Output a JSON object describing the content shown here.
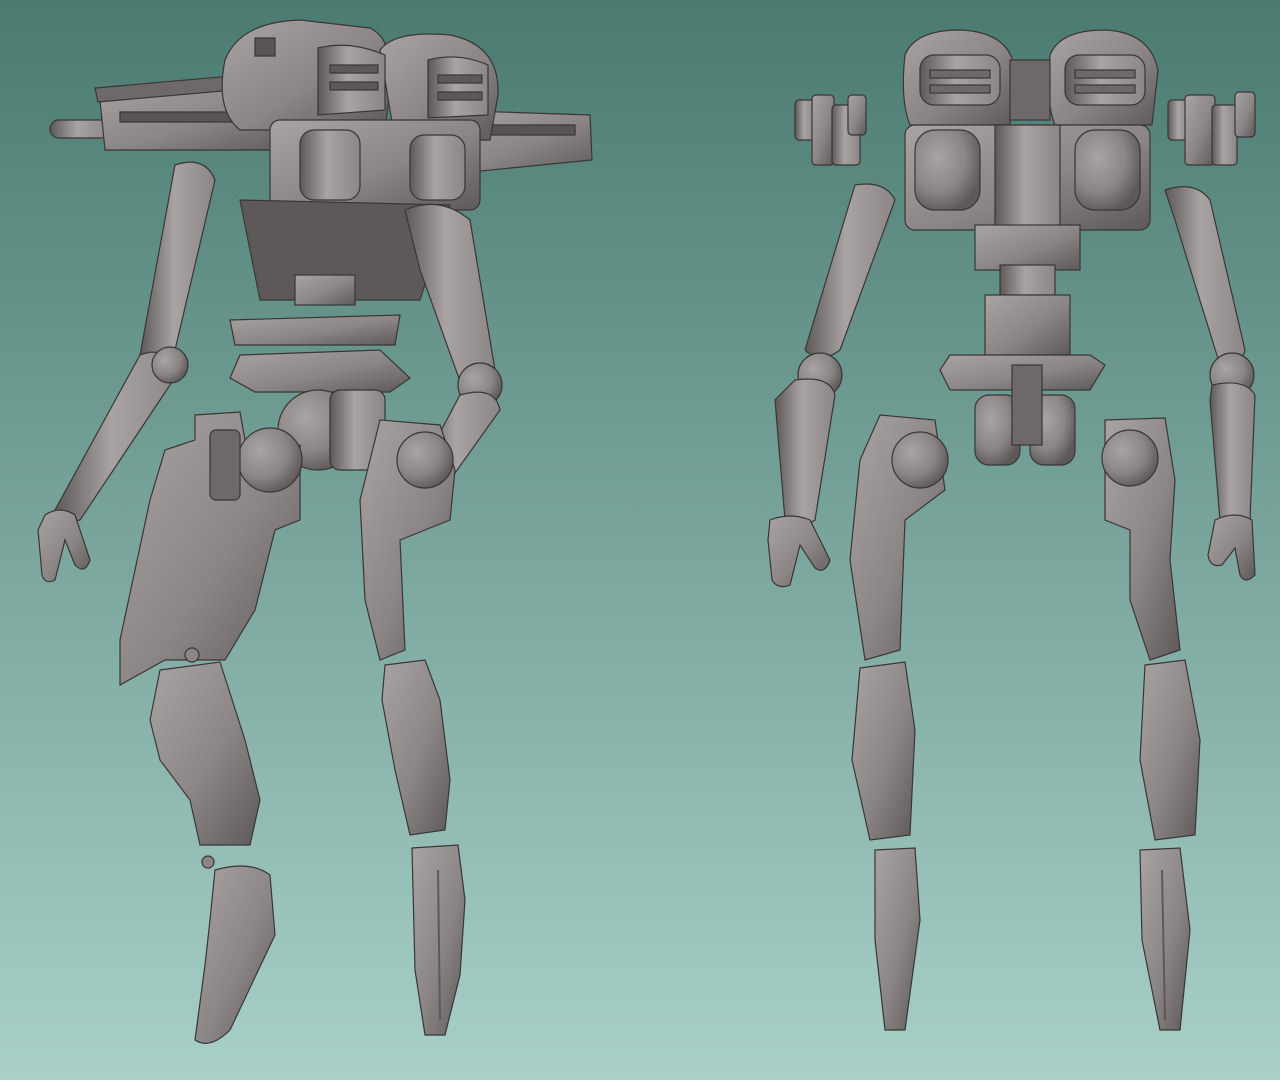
{
  "colors": {
    "background_top": "#4a7a70",
    "background_bottom": "#a8d0c8",
    "clay_light": "#a9a3a3",
    "clay_mid": "#8b8585",
    "clay_dark": "#5e5959",
    "clay_shadow": "#403c3c"
  },
  "views": [
    {
      "name": "three-quarter-view",
      "parts": [
        "turret-pod",
        "gun-barrel",
        "left-arm",
        "right-arm",
        "pelvis",
        "left-thigh",
        "left-shin",
        "left-foot",
        "right-thigh",
        "right-shin",
        "right-foot"
      ]
    },
    {
      "name": "front-view",
      "parts": [
        "turret-pod",
        "left-hand",
        "right-hand",
        "left-arm",
        "right-arm",
        "pelvis",
        "left-thigh",
        "left-shin",
        "left-foot",
        "right-thigh",
        "right-shin",
        "right-foot"
      ]
    }
  ]
}
